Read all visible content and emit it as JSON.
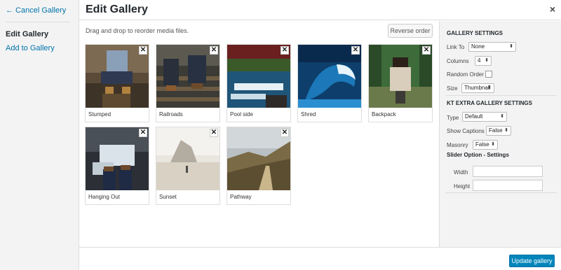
{
  "sidebar": {
    "cancel_label": "← Cancel Gallery",
    "active_label": "Edit Gallery",
    "add_label": "Add to Gallery"
  },
  "header": {
    "title": "Edit Gallery",
    "close_glyph": "×"
  },
  "main": {
    "instructions": "Drag and drop to reorder media files.",
    "reverse_label": "Reverse order",
    "remove_glyph": "✕",
    "items": [
      {
        "caption": "Stumped"
      },
      {
        "caption": "Railroads"
      },
      {
        "caption": "Pool side"
      },
      {
        "caption": "Shred"
      },
      {
        "caption": "Backpack"
      },
      {
        "caption": "Hanging Out"
      },
      {
        "caption": "Sunset"
      },
      {
        "caption": "Pathway"
      }
    ]
  },
  "settings": {
    "gallery_heading": "GALLERY SETTINGS",
    "link_to_label": "Link To",
    "link_to_value": "None",
    "columns_label": "Columns",
    "columns_value": "4",
    "random_order_label": "Random Order",
    "size_label": "Size",
    "size_value": "Thumbnail",
    "extra_heading": "KT EXTRA GALLERY SETTINGS",
    "type_label": "Type",
    "type_value": "Default",
    "captions_label": "Show Captions",
    "captions_value": "False",
    "masonry_label": "Masonry",
    "masonry_value": "False",
    "slider_heading": "Slider Option - Settings",
    "width_label": "Width",
    "height_label": "Height",
    "select_arrow": "⬍"
  },
  "footer": {
    "update_label": "Update gallery"
  },
  "colors": {
    "accent": "#0085ba",
    "link": "#0073aa"
  }
}
